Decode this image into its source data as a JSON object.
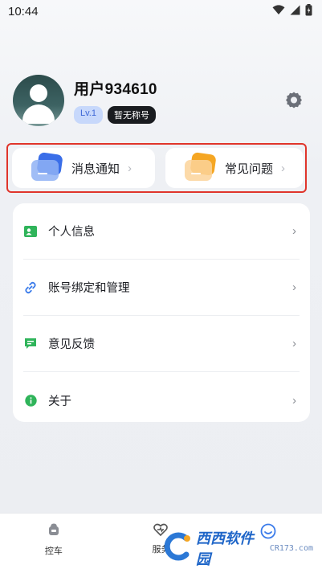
{
  "status_bar": {
    "time": "10:44",
    "icons": [
      "wifi-icon",
      "signal-icon",
      "battery-icon"
    ]
  },
  "profile": {
    "username": "用户934610",
    "level_badge": "Lv.1",
    "title_badge": "暂无称号",
    "settings_icon": "gear-icon"
  },
  "quick_actions": [
    {
      "label": "消息通知",
      "icon": "message-cards-icon",
      "color": "#3a6ee8"
    },
    {
      "label": "常见问题",
      "icon": "faq-cards-icon",
      "color": "#f5a623"
    }
  ],
  "menu": [
    {
      "label": "个人信息",
      "icon": "id-card-icon",
      "color": "#2fb45a"
    },
    {
      "label": "账号绑定和管理",
      "icon": "link-icon",
      "color": "#3a7bea"
    },
    {
      "label": "意见反馈",
      "icon": "feedback-icon",
      "color": "#2fb45a"
    },
    {
      "label": "关于",
      "icon": "info-icon",
      "color": "#2fb45a"
    }
  ],
  "tabs": [
    {
      "label": "控车",
      "icon": "car-control-icon"
    },
    {
      "label": "服务",
      "icon": "service-icon"
    },
    {
      "label": "",
      "icon": "profile-smile-icon",
      "active": true
    }
  ],
  "watermark": {
    "text": "西西软件园",
    "sub": "CR173.com"
  },
  "colors": {
    "accent": "#3d67d6",
    "highlight_border": "#e0352b",
    "active_tab": "#3a7bea"
  }
}
